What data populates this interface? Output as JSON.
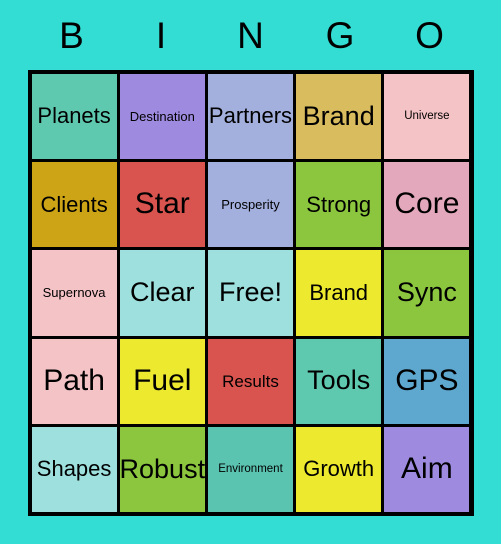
{
  "card": {
    "header_letters": [
      "B",
      "I",
      "N",
      "G",
      "O"
    ],
    "background_color": "#33DDD3",
    "grid_line_color": "#000000",
    "text_color": "#000000",
    "free_space": {
      "row": 3,
      "column": 3,
      "label": "Free!"
    },
    "rows": [
      [
        {
          "label": "Planets",
          "color": "#5FC9B0",
          "size": "md"
        },
        {
          "label": "Destination",
          "color": "#9E8BE0",
          "size": "xs"
        },
        {
          "label": "Partners",
          "color": "#A3AFDD",
          "size": "md"
        },
        {
          "label": "Brand",
          "color": "#D9BC5E",
          "size": "lg"
        },
        {
          "label": "Universe",
          "color": "#F4C3C6",
          "size": "xxs"
        }
      ],
      [
        {
          "label": "Clients",
          "color": "#CCA416",
          "size": "md"
        },
        {
          "label": "Star",
          "color": "#D9534F",
          "size": "xl"
        },
        {
          "label": "Prosperity",
          "color": "#A3AFDD",
          "size": "xs"
        },
        {
          "label": "Strong",
          "color": "#8CC63E",
          "size": "md"
        },
        {
          "label": "Core",
          "color": "#E3A8BC",
          "size": "xl"
        }
      ],
      [
        {
          "label": "Supernova",
          "color": "#F4C3C6",
          "size": "xs"
        },
        {
          "label": "Clear",
          "color": "#9DE0DE",
          "size": "lg"
        },
        {
          "label": "Free!",
          "color": "#9DE0DE",
          "size": "lg"
        },
        {
          "label": "Brand",
          "color": "#EDE92E",
          "size": "md"
        },
        {
          "label": "Sync",
          "color": "#8CC63E",
          "size": "lg"
        }
      ],
      [
        {
          "label": "Path",
          "color": "#F4C3C6",
          "size": "xl"
        },
        {
          "label": "Fuel",
          "color": "#EDE92E",
          "size": "xl"
        },
        {
          "label": "Results",
          "color": "#D9534F",
          "size": "sm"
        },
        {
          "label": "Tools",
          "color": "#5FC9B0",
          "size": "lg"
        },
        {
          "label": "GPS",
          "color": "#5EA8D0",
          "size": "xl"
        }
      ],
      [
        {
          "label": "Shapes",
          "color": "#9DE0DE",
          "size": "md"
        },
        {
          "label": "Robust",
          "color": "#8CC63E",
          "size": "lg"
        },
        {
          "label": "Environment",
          "color": "#5BC4B1",
          "size": "xxs"
        },
        {
          "label": "Growth",
          "color": "#EDE92E",
          "size": "md"
        },
        {
          "label": "Aim",
          "color": "#9E8BE0",
          "size": "xl"
        }
      ]
    ]
  }
}
